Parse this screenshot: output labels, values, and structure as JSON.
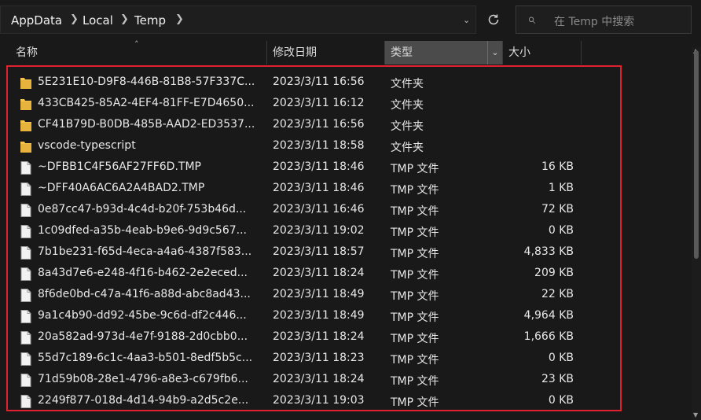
{
  "breadcrumb": {
    "items": [
      "AppData",
      "Local",
      "Temp"
    ]
  },
  "search": {
    "placeholder": "在 Temp 中搜索"
  },
  "columns": {
    "name": "名称",
    "date": "修改日期",
    "type": "类型",
    "size": "大小"
  },
  "rows": [
    {
      "icon": "folder-icon",
      "name": "5E231E10-D9F8-446B-81B8-57F337C...",
      "date": "2023/3/11 16:56",
      "type": "文件夹",
      "size": ""
    },
    {
      "icon": "folder-icon",
      "name": "433CB425-85A2-4EF4-81FF-E7D4650...",
      "date": "2023/3/11 16:12",
      "type": "文件夹",
      "size": ""
    },
    {
      "icon": "folder-icon",
      "name": "CF41B79D-B0DB-485B-AAD2-ED3537...",
      "date": "2023/3/11 16:56",
      "type": "文件夹",
      "size": ""
    },
    {
      "icon": "folder-icon",
      "name": "vscode-typescript",
      "date": "2023/3/11 18:58",
      "type": "文件夹",
      "size": ""
    },
    {
      "icon": "file-icon",
      "name": "~DFBB1C4F56AF27FF6D.TMP",
      "date": "2023/3/11 18:46",
      "type": "TMP 文件",
      "size": "16 KB"
    },
    {
      "icon": "file-icon",
      "name": "~DFF40A6AC6A2A4BAD2.TMP",
      "date": "2023/3/11 18:46",
      "type": "TMP 文件",
      "size": "1 KB"
    },
    {
      "icon": "file-icon",
      "name": "0e87cc47-b93d-4c4d-b20f-753b46d...",
      "date": "2023/3/11 16:46",
      "type": "TMP 文件",
      "size": "72 KB"
    },
    {
      "icon": "file-icon",
      "name": "1c09dfed-a35b-4eab-b9e6-9d9c567...",
      "date": "2023/3/11 19:02",
      "type": "TMP 文件",
      "size": "0 KB"
    },
    {
      "icon": "file-icon",
      "name": "7b1be231-f65d-4eca-a4a6-4387f583...",
      "date": "2023/3/11 18:57",
      "type": "TMP 文件",
      "size": "4,833 KB"
    },
    {
      "icon": "file-icon",
      "name": "8a43d7e6-e248-4f16-b462-2e2eced...",
      "date": "2023/3/11 18:24",
      "type": "TMP 文件",
      "size": "209 KB"
    },
    {
      "icon": "file-icon",
      "name": "8f6de0bd-c47a-41f6-a88d-abc8ad43...",
      "date": "2023/3/11 18:49",
      "type": "TMP 文件",
      "size": "22 KB"
    },
    {
      "icon": "file-icon",
      "name": "9a1c4b90-dd92-45be-9c6d-df2c446...",
      "date": "2023/3/11 18:49",
      "type": "TMP 文件",
      "size": "4,964 KB"
    },
    {
      "icon": "file-icon",
      "name": "20a582ad-973d-4e7f-9188-2d0cbb0...",
      "date": "2023/3/11 18:24",
      "type": "TMP 文件",
      "size": "1,666 KB"
    },
    {
      "icon": "file-icon",
      "name": "55d7c189-6c1c-4aa3-b501-8edf5b5c...",
      "date": "2023/3/11 18:23",
      "type": "TMP 文件",
      "size": "0 KB"
    },
    {
      "icon": "file-icon",
      "name": "71d59b08-28e1-4796-a8e3-c679fb6...",
      "date": "2023/3/11 18:24",
      "type": "TMP 文件",
      "size": "23 KB"
    },
    {
      "icon": "file-icon",
      "name": "2249f877-018d-4d14-94b9-a2d5c2e...",
      "date": "2023/3/11 19:03",
      "type": "TMP 文件",
      "size": "0 KB"
    }
  ],
  "colors": {
    "background": "#191919",
    "selection_box": "#e0212f",
    "folder": "#f4c44e"
  }
}
